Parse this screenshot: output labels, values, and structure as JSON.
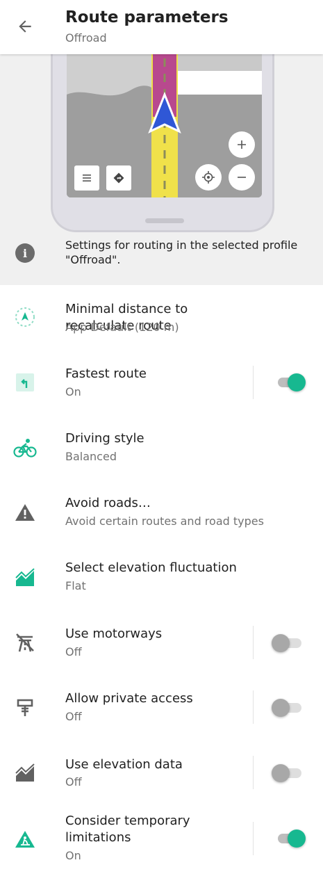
{
  "header": {
    "title": "Route parameters",
    "subtitle": "Offroad",
    "back_icon": "arrow-left-icon"
  },
  "info": {
    "text": "Settings for routing in the selected profile \"Offroad\".",
    "icon": "info-icon"
  },
  "colors": {
    "accent": "#17b890",
    "icon_gray": "#616161",
    "text_secondary": "#727272"
  },
  "items": [
    {
      "label": "Minimal distance to recalculate route",
      "desc": "App Default (120 m)",
      "icon": "recalculate-route-icon"
    },
    {
      "label": "Fastest route",
      "desc": "On",
      "icon": "fastest-route-icon",
      "toggle": true
    },
    {
      "label": "Driving style",
      "desc": "Balanced",
      "icon": "bicycle-icon"
    },
    {
      "label": "Avoid roads…",
      "desc": "Avoid certain routes and road types",
      "icon": "warning-icon"
    },
    {
      "label": "Select elevation fluctuation",
      "desc": "Flat",
      "icon": "elevation-icon"
    },
    {
      "label": "Use motorways",
      "desc": "Off",
      "icon": "no-motorway-icon",
      "toggle": false
    },
    {
      "label": "Allow private access",
      "desc": "Off",
      "icon": "private-access-icon",
      "toggle": false
    },
    {
      "label": "Use elevation data",
      "desc": "Off",
      "icon": "elevation-data-icon",
      "toggle": false
    },
    {
      "label": "Consider temporary limitations",
      "desc": "On",
      "icon": "roadworks-icon",
      "toggle": true
    }
  ]
}
